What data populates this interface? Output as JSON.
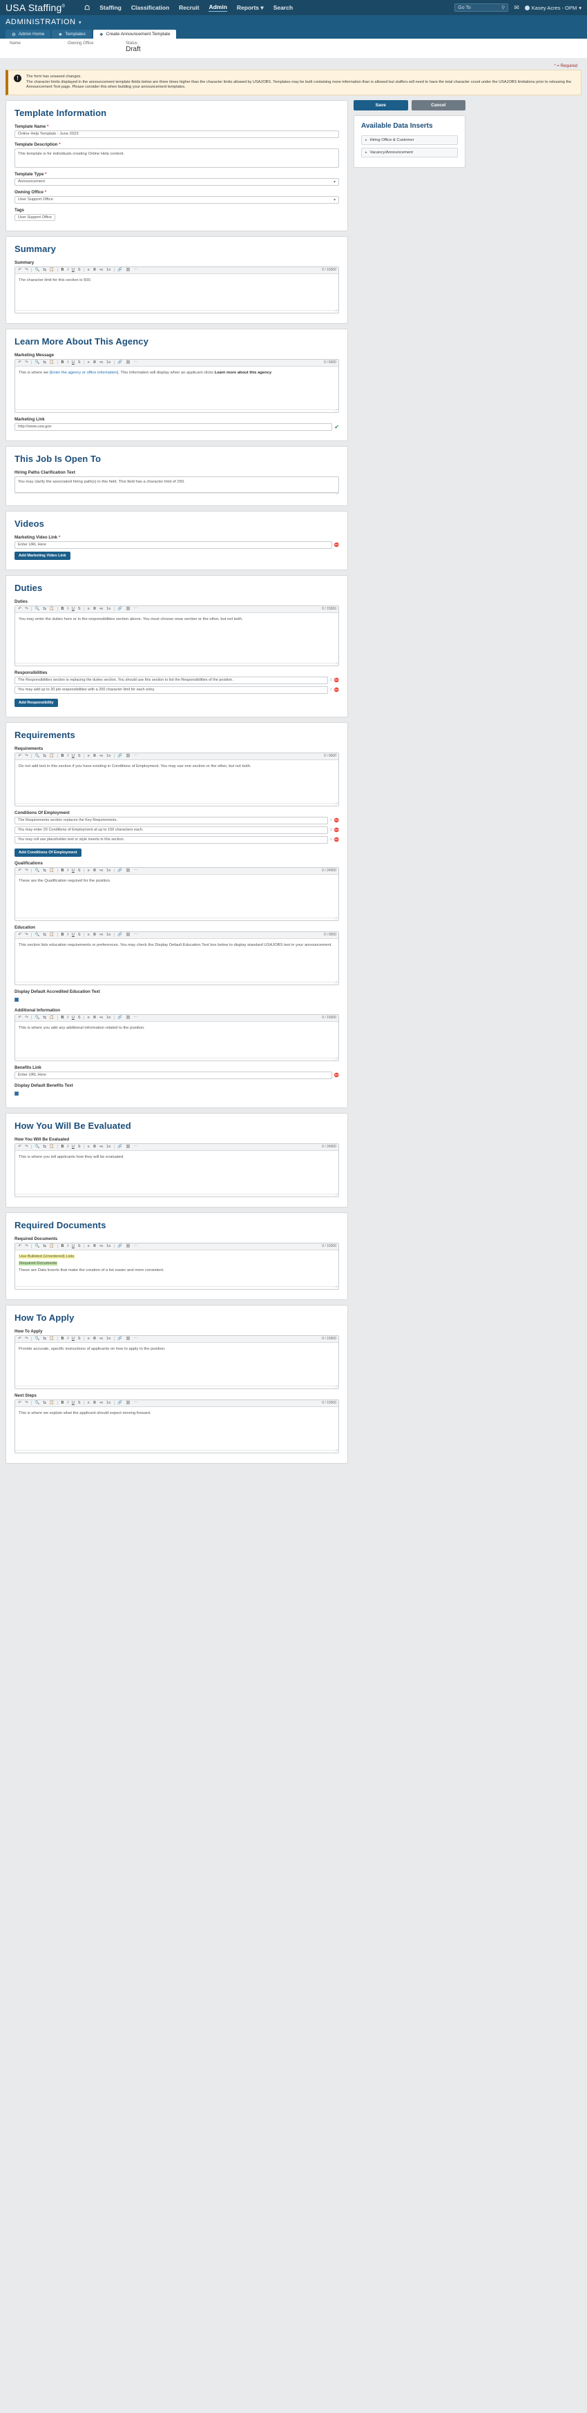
{
  "topnav": {
    "brand": "USA Staffing",
    "brand_sup": "®",
    "home_icon": "home-icon",
    "links": [
      {
        "label": "Staffing",
        "active": false
      },
      {
        "label": "Classification",
        "active": false
      },
      {
        "label": "Recruit",
        "active": false
      },
      {
        "label": "Admin",
        "active": true
      },
      {
        "label": "Reports",
        "active": false,
        "caret": true
      },
      {
        "label": "Search",
        "active": false
      }
    ],
    "goto_placeholder": "Go To",
    "mail_icon": "mail-icon",
    "user": "Kasey Acres - OPM"
  },
  "appbar": {
    "title": "ADMINISTRATION"
  },
  "tabs": [
    {
      "label": "Admin Home",
      "icon": "gear-icon",
      "active": false
    },
    {
      "label": "Templates",
      "icon": "puzzle-icon",
      "active": false
    },
    {
      "label": "Create Announcement Template",
      "icon": "puzzle-icon",
      "active": true
    }
  ],
  "record": {
    "columns": [
      {
        "label": "Name",
        "value": ""
      },
      {
        "label": "Owning Office",
        "value": ""
      },
      {
        "label": "Status",
        "value": "Draft"
      }
    ]
  },
  "required_note": {
    "star": "*",
    "text": " = Required"
  },
  "alert": {
    "icon": "exclamation-icon",
    "line1": "The form has unsaved changes.",
    "line2": "The character limits displayed in the announcement template fields below are three times higher than the character limits allowed by USAJOBS. Templates may be built containing more information than is allowed but staffers will need to have the total character count under the USAJOBS limitations prior to releasing the Announcement Text page. Please consider this when building your announcement templates."
  },
  "sidebar": {
    "save_label": "Save",
    "cancel_label": "Cancel",
    "inserts_title": "Available Data Inserts",
    "inserts": [
      {
        "label": "Hiring Office & Customer",
        "icon": "chevron-right-icon"
      },
      {
        "label": "Vacancy/Announcement",
        "icon": "chevron-right-icon"
      }
    ]
  },
  "template_information": {
    "heading": "Template Information",
    "template_name": {
      "label": "Template Name",
      "required": true,
      "value": "Online Help Template - June 2023"
    },
    "template_description": {
      "label": "Template Description",
      "required": true,
      "value": "This template is for individuals creating Online Help content."
    },
    "template_type": {
      "label": "Template Type",
      "required": true,
      "value": "Announcement"
    },
    "owning_office": {
      "label": "Owning Office",
      "required": true,
      "value": "User Support Office"
    },
    "tags": {
      "label": "Tags",
      "required": false,
      "values": [
        "User Support Office"
      ]
    }
  },
  "toolbar": {
    "undo": "↶",
    "redo": "↷",
    "search": "🔍",
    "replace": "⇆",
    "paste": "📋",
    "bold": "B",
    "italic": "I",
    "underline": "U",
    "strike": "S",
    "align_left": "≡",
    "align_center": "≣",
    "bullets": "•≡",
    "numbers": "1≡",
    "link": "🔗",
    "unlink": "⛓",
    "more": "⋯"
  },
  "sections": [
    {
      "heading": "Summary",
      "fields": [
        {
          "type": "rte",
          "label": "Summary",
          "counter": "0 / 15000",
          "body": "The character limit for this section is 500.",
          "height": 52
        }
      ]
    },
    {
      "heading": "Learn More About This Agency",
      "fields": [
        {
          "type": "rte",
          "label": "Marketing Message",
          "counter": "0 / 6000",
          "body_html": "This is where we <span class='blue'>[Enter the agency or office information]</span>. This information will display when an applicant clicks <b>Learn more about this agency</b>.",
          "height": 62
        },
        {
          "type": "link",
          "label": "Marketing Link",
          "value": "http://www.usa.gov",
          "check": "✔"
        }
      ]
    },
    {
      "heading": "This Job Is Open To",
      "fields": [
        {
          "type": "textarea",
          "label": "Hiring Paths Clarification Text",
          "value": "You may clarify the associated hiring path(s) in this field. This field has a character limit of 250.",
          "height": 24
        }
      ]
    },
    {
      "heading": "Videos",
      "fields": [
        {
          "type": "link",
          "label": "Marketing Video Link",
          "required": true,
          "value": "Enter URL Here"
        },
        {
          "type": "button",
          "label": "Add Marketing Video Link"
        }
      ]
    },
    {
      "heading": "Duties",
      "fields": [
        {
          "type": "rte",
          "label": "Duties",
          "counter": "0 / 15000",
          "body": "You may enter the duties here or in the responsibilities section above. You must choose onse section or the other, but not both.",
          "height": 72
        },
        {
          "type": "lines",
          "label": "Responsibilities",
          "lines": [
            "The Responsibilities section is replacing the duties section. You should use this section to list the Responsibilities of the position.",
            "You may add up to 20 job responsibilities with a 200 character limit for each entry."
          ]
        },
        {
          "type": "button",
          "label": "Add Responsibility"
        }
      ]
    },
    {
      "heading": "Requirements",
      "fields": [
        {
          "type": "rte",
          "label": "Requirements",
          "counter": "0 / 9000",
          "body": "Do not add text in this section if you have existing in Conditions of Employment. You may use one section or the other, but not both.",
          "height": 62
        },
        {
          "type": "lines",
          "label": "Conditions Of Employment",
          "lines": [
            "The Requirements section replaces the Key Requirements.",
            "You may enter 20 Conditions of Employment at up to 150 characters each.",
            "You may roll use placeholder text or style inserts in this section."
          ]
        },
        {
          "type": "button",
          "label": "Add Conditions Of Employment"
        },
        {
          "type": "rte",
          "label": "Qualifications",
          "counter": "0 / 24000",
          "body": "These are the Qualification required for the position.",
          "height": 62
        },
        {
          "type": "rte",
          "label": "Education",
          "counter": "0 / 9000",
          "body": "This section lists education requirements or preferences. You may check the Display Default Education Text box below to display standard USAJOBS text in your announcement.",
          "height": 62
        },
        {
          "type": "checkbox",
          "label": "Display Default Accredited Education Text",
          "checked": true
        },
        {
          "type": "rte",
          "label": "Additional Information",
          "counter": "0 / 15000",
          "body": "This is where you add any additional information related to the position.",
          "height": 52
        },
        {
          "type": "link",
          "label": "Benefits Link",
          "value": "Enter URL Here"
        },
        {
          "type": "checkbox",
          "label": "Display Default Benefits Text",
          "checked": true
        }
      ]
    },
    {
      "heading": "How You Will Be Evaluated",
      "fields": [
        {
          "type": "rte",
          "label": "How You Will Be Evaluated",
          "counter": "0 / 24000",
          "body": "This is where you tell applicants how they will be evaluated.",
          "height": 62
        }
      ]
    },
    {
      "heading": "Required Documents",
      "fields": [
        {
          "type": "rte",
          "label": "Required Documents",
          "counter": "0 / 15000",
          "body_doc": true,
          "chips": [
            "Use Bulleted (Unordered) Lists",
            "Required Documents",
            "These are Data Inserts that make the creation of a list easier and more consistent."
          ],
          "height": 52
        }
      ]
    },
    {
      "heading": "How To Apply",
      "fields": [
        {
          "type": "rte",
          "label": "How To Apply",
          "counter": "0 / 15000",
          "body": "Provide accurate, specific instructions of applicants on how to apply to the position.",
          "height": 62
        },
        {
          "type": "rte",
          "label": "Next Steps",
          "counter": "0 / 15000",
          "body": "This is where we explain what the applicant should expect moving forward.",
          "height": 62
        }
      ]
    }
  ]
}
